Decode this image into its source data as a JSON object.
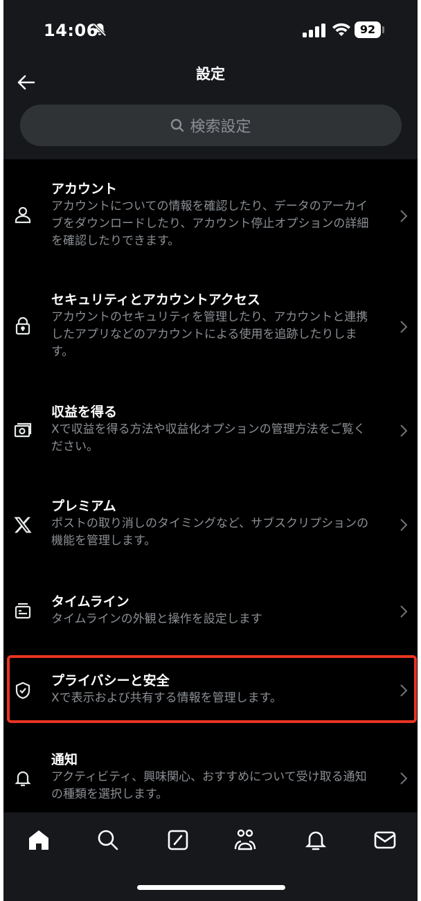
{
  "status_bar": {
    "time": "14:06",
    "battery": "92"
  },
  "header": {
    "title": "設定",
    "search_placeholder": "検索設定"
  },
  "settings": [
    {
      "title": "アカウント",
      "description": "アカウントについての情報を確認したり、データのアーカイブをダウンロードしたり、アカウント停止オプションの詳細を確認したりできます。",
      "icon": "person-icon"
    },
    {
      "title": "セキュリティとアカウントアクセス",
      "description": "アカウントのセキュリティを管理したり、アカウントと連携したアプリなどのアカウントによる使用を追跡したりします。",
      "icon": "lock-icon"
    },
    {
      "title": "収益を得る",
      "description": "Xで収益を得る方法や収益化オプションの管理方法をご覧ください。",
      "icon": "money-icon"
    },
    {
      "title": "プレミアム",
      "description": "ポストの取り消しのタイミングなど、サブスクリプションの機能を管理します。",
      "icon": "x-logo-icon"
    },
    {
      "title": "タイムライン",
      "description": "タイムラインの外観と操作を設定します",
      "icon": "timeline-icon"
    },
    {
      "title": "プライバシーと安全",
      "description": "Xで表示および共有する情報を管理します。",
      "icon": "shield-icon"
    },
    {
      "title": "通知",
      "description": "アクティビティ、興味関心、おすすめについて受け取る通知の種類を選択します。",
      "icon": "bell-icon"
    }
  ],
  "highlight_color": "#ea3323",
  "tabbar": [
    "home-icon",
    "search-icon",
    "compose-icon",
    "communities-icon",
    "notifications-icon",
    "messages-icon"
  ]
}
